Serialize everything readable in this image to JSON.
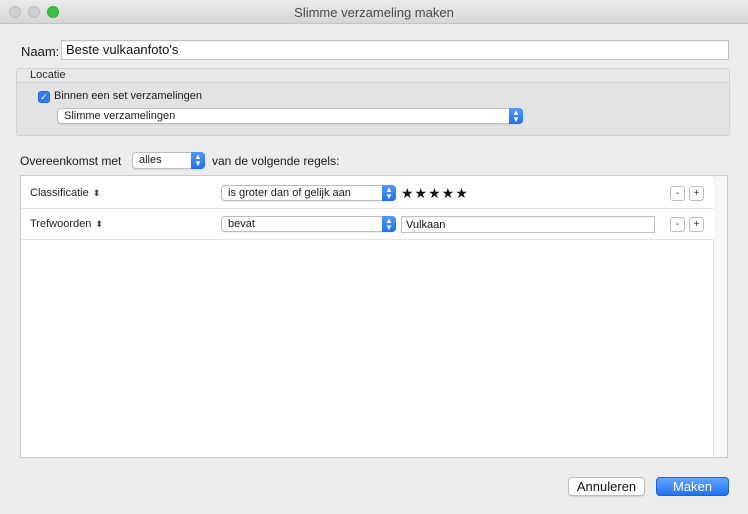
{
  "window": {
    "title": "Slimme verzameling maken"
  },
  "name": {
    "label": "Naam:",
    "value": "Beste vulkaanfoto's"
  },
  "location": {
    "group_label": "Locatie",
    "checkbox_label": "Binnen een set verzamelingen",
    "checkbox_checked": true,
    "set_value": "Slimme verzamelingen"
  },
  "match": {
    "prefix": "Overeenkomst met",
    "value": "alles",
    "suffix": "van de volgende regels:"
  },
  "rules": [
    {
      "field": "Classificatie",
      "operator": "is groter dan of gelijk aan",
      "rating": 5,
      "stars": "★★★★★"
    },
    {
      "field": "Trefwoorden",
      "operator": "bevat",
      "value": "Vulkaan"
    }
  ],
  "icons": {
    "updown": "⬍",
    "select_arrow_up": "▲",
    "select_arrow_down": "▼",
    "check": "✓"
  },
  "rule_buttons": {
    "remove": "-",
    "add": "+"
  },
  "buttons": {
    "cancel": "Annuleren",
    "ok": "Maken"
  },
  "colors": {
    "accent": "#2f7cf6",
    "window_bg": "#ececec"
  }
}
